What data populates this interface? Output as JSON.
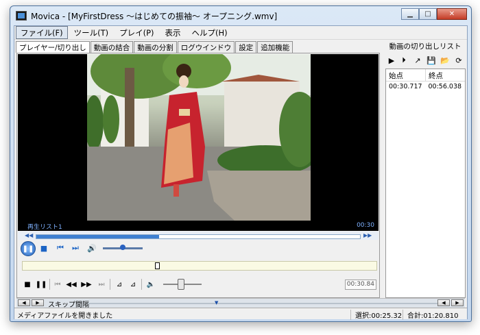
{
  "window": {
    "title": "Movica - [MyFirstDress ～はじめての振袖～ オープニング.wmv]"
  },
  "menu": [
    {
      "label": "ファイル(F)"
    },
    {
      "label": "ツール(T)"
    },
    {
      "label": "プレイ(P)"
    },
    {
      "label": "表示"
    },
    {
      "label": "ヘルプ(H)"
    }
  ],
  "tabs": [
    {
      "label": "プレイヤー/切り出し",
      "selected": true
    },
    {
      "label": "動画の結合"
    },
    {
      "label": "動画の分割"
    },
    {
      "label": "ログウインドウ"
    },
    {
      "label": "設定"
    },
    {
      "label": "追加機能"
    }
  ],
  "player": {
    "playlist_label": "再生リスト1",
    "time_label": "00:30",
    "position_fraction": 0.38,
    "volume_fraction": 0.5,
    "time_display": "00:30.84",
    "edit_volume_fraction": 0.45
  },
  "cutlist": {
    "header": "動画の切り出しリスト",
    "columns": [
      "始点",
      "終点"
    ],
    "rows": [
      {
        "start": "00:30.717",
        "end": "00:56.038"
      }
    ]
  },
  "skip": {
    "label": "スキップ間隔"
  },
  "status": {
    "message": "メディアファイルを開きました",
    "selection": "選択:00:25.32",
    "total": "合計:01:20.810"
  },
  "colors": {
    "accent": "#1e5fb8",
    "title_bg": "#c4d7ee",
    "close_button": "#c33b25",
    "video_bg": "#000000",
    "edit_strip": "#fafae4"
  },
  "icons": {
    "app": "film-icon",
    "play": "play-icon",
    "pause": "pause-icon",
    "stop": "stop-icon",
    "volume": "speaker-icon",
    "save": "save-icon",
    "open": "folder-open-icon",
    "refresh": "refresh-icon"
  }
}
